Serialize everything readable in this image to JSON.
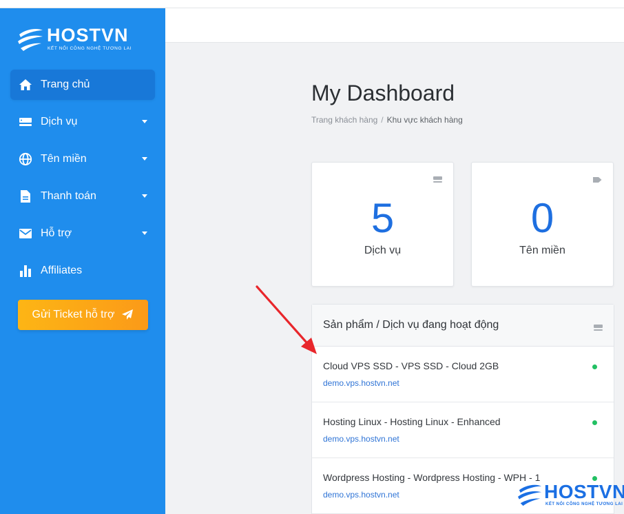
{
  "brand": {
    "name": "HOSTVN",
    "tagline": "KẾT NỐI CÔNG NGHỆ TƯƠNG LAI",
    "color_primary": "#1f8ded",
    "color_accent": "#fb9a18"
  },
  "sidebar": {
    "items": [
      {
        "label": "Trang chủ",
        "icon": "home-icon",
        "active": true,
        "has_caret": false
      },
      {
        "label": "Dịch vụ",
        "icon": "server-icon",
        "active": false,
        "has_caret": true
      },
      {
        "label": "Tên miền",
        "icon": "globe-icon",
        "active": false,
        "has_caret": true
      },
      {
        "label": "Thanh toán",
        "icon": "document-icon",
        "active": false,
        "has_caret": true
      },
      {
        "label": "Hỗ trợ",
        "icon": "envelope-icon",
        "active": false,
        "has_caret": true
      },
      {
        "label": "Affiliates",
        "icon": "bar-chart-icon",
        "active": false,
        "has_caret": false
      }
    ],
    "ticket_button": {
      "label": "Gửi Ticket hỗ trợ",
      "icon": "paper-plane-icon"
    }
  },
  "main": {
    "title": "My Dashboard",
    "breadcrumb": {
      "parent": "Trang khách hàng",
      "separator": "/",
      "current": "Khu vực khách hàng"
    },
    "stats": [
      {
        "value": "5",
        "label": "Dịch vụ",
        "icon": "server-icon"
      },
      {
        "value": "0",
        "label": "Tên miền",
        "icon": "tag-icon"
      }
    ],
    "products": {
      "title": "Sản phẩm / Dịch vụ đang hoạt động",
      "icon": "server-icon",
      "status_color": "#22c063",
      "rows": [
        {
          "name": "Cloud VPS SSD - VPS SSD - Cloud 2GB",
          "domain": "demo.vps.hostvn.net",
          "status": "active"
        },
        {
          "name": "Hosting Linux - Hosting Linux - Enhanced",
          "domain": "demo.vps.hostvn.net",
          "status": "active"
        },
        {
          "name": "Wordpress Hosting - Wordpress Hosting - WPH - 1",
          "domain": "demo.vps.hostvn.net",
          "status": "active"
        }
      ]
    }
  },
  "annotation": {
    "type": "arrow",
    "color": "#e8262b"
  },
  "watermark": {
    "name": "HOSTVN",
    "tagline": "KẾT NỐI CÔNG NGHỆ TƯƠNG LAI"
  }
}
